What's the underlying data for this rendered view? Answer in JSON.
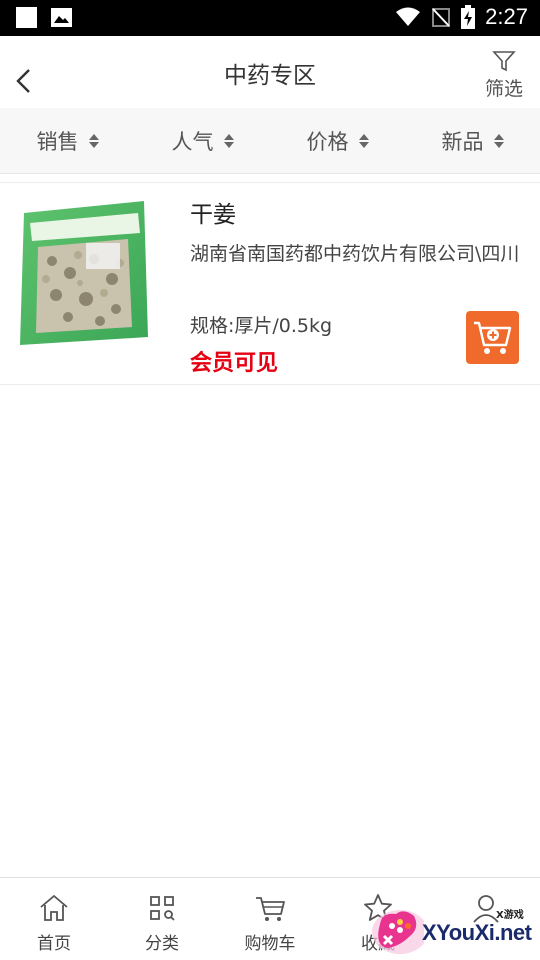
{
  "status_bar": {
    "time": "2:27",
    "icons": [
      "square-icon",
      "image-icon",
      "wifi-icon",
      "no-signal-icon",
      "battery-charging-icon"
    ]
  },
  "header": {
    "title": "中药专区",
    "back_icon": "chevron-left-icon",
    "filter_label": "筛选",
    "filter_icon": "funnel-icon"
  },
  "sort_bar": {
    "items": [
      {
        "label": "销售"
      },
      {
        "label": "人气"
      },
      {
        "label": "价格"
      },
      {
        "label": "新品"
      }
    ]
  },
  "products": [
    {
      "name": "干姜",
      "supplier": "湖南省南国药都中药饮片有限公司\\四川",
      "spec": "规格:厚片/0.5kg",
      "price_text": "会员可见",
      "cart_icon": "add-to-cart-icon",
      "image_icon": "herb-package-image"
    }
  ],
  "tab_bar": {
    "tabs": [
      {
        "label": "首页",
        "icon": "home-icon"
      },
      {
        "label": "分类",
        "icon": "category-icon"
      },
      {
        "label": "购物车",
        "icon": "cart-icon"
      },
      {
        "label": "收藏",
        "icon": "star-icon"
      },
      {
        "label": "",
        "icon": "user-icon"
      }
    ]
  },
  "watermark": {
    "text": "XYouXi.net",
    "small_text": "X游戏"
  },
  "colors": {
    "accent": "#f06a2b",
    "price": "#e60012",
    "status_bar": "#000000",
    "sort_bar_bg": "#f7f7f7"
  }
}
